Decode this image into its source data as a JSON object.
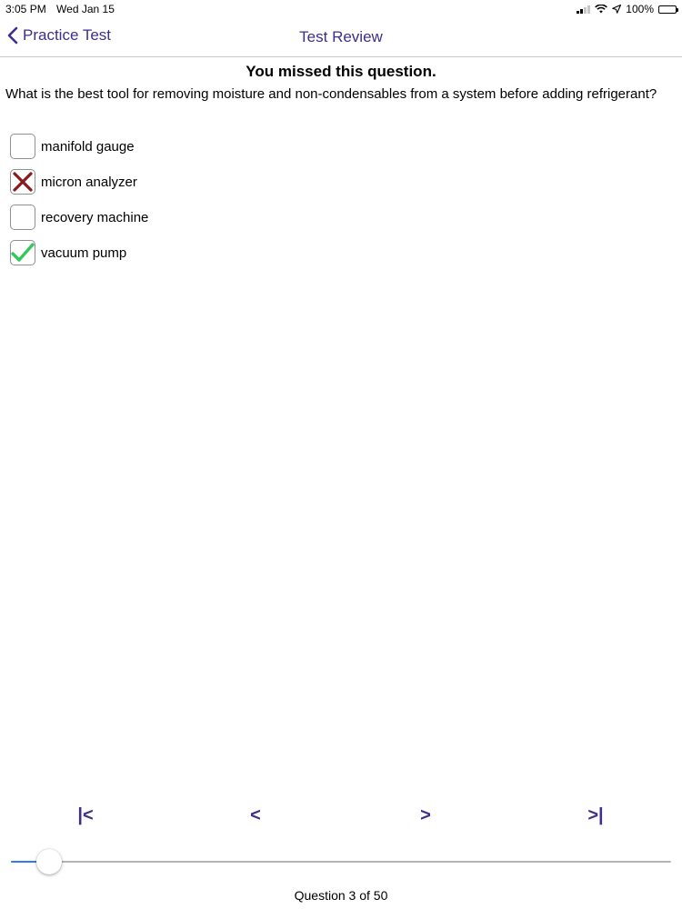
{
  "status_bar": {
    "time": "3:05 PM",
    "date": "Wed Jan 15",
    "battery": "100%"
  },
  "nav": {
    "back_label": "Practice Test",
    "title": "Test Review"
  },
  "colors": {
    "accent": "#3d2f8a",
    "wrong": "#8b1a1a",
    "correct": "#34c759",
    "slider": "#3478f6"
  },
  "result_heading": "You missed this question.",
  "question": "What is the best tool for removing moisture and non-condensables from a system before adding refrigerant?",
  "options": [
    {
      "label": "manifold gauge",
      "mark": "none"
    },
    {
      "label": "micron analyzer",
      "mark": "wrong"
    },
    {
      "label": "recovery machine",
      "mark": "none"
    },
    {
      "label": "vacuum pump",
      "mark": "correct"
    }
  ],
  "pager": {
    "first": "|<",
    "prev": "<",
    "next": ">",
    "last": ">|"
  },
  "progress": {
    "current": 3,
    "total": 50
  },
  "footer_text": "Question 3 of 50"
}
